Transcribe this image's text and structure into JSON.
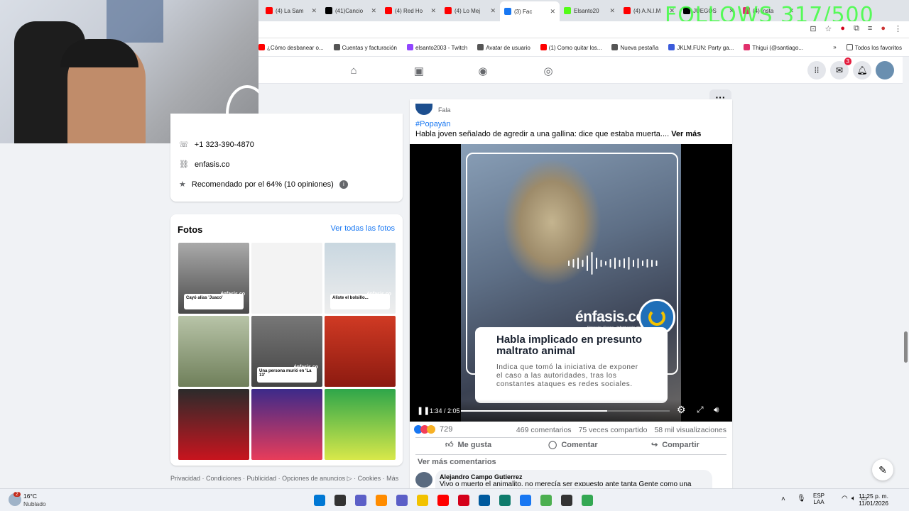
{
  "browser": {
    "tabs": [
      {
        "label": "(4) La Sam",
        "color": "#ff0000"
      },
      {
        "label": "(41)Cancio",
        "color": "#000000"
      },
      {
        "label": "(4) Red Ho",
        "color": "#ff0000"
      },
      {
        "label": "(4) Lo Mej",
        "color": "#ff0000"
      },
      {
        "label": "(3) Fac",
        "color": "#1877f2"
      },
      {
        "label": "Elsanto20",
        "color": "#53fc18"
      },
      {
        "label": "(4) A.N.I.M",
        "color": "#ff0000"
      },
      {
        "label": "JUEGOS",
        "color": "#000000"
      },
      {
        "label": "(4) Insta",
        "color": "#e1306c"
      }
    ],
    "bookmarks": [
      {
        "label": "¿Cómo desbanear o...",
        "color": "#ff0000"
      },
      {
        "label": "Cuentas y facturación",
        "color": "#555555"
      },
      {
        "label": "elsanto2003 - Twitch",
        "color": "#9146ff"
      },
      {
        "label": "Avatar de usuario",
        "color": "#555555"
      },
      {
        "label": "(1) Como quitar los...",
        "color": "#ff0000"
      },
      {
        "label": "Nueva pestaña",
        "color": "#555555"
      },
      {
        "label": "JKLM.FUN: Party ga...",
        "color": "#3b5bdb"
      },
      {
        "label": "Thigui (@santiago...",
        "color": "#e1306c"
      }
    ],
    "all_bookmarks": "Todos los favoritos"
  },
  "overlay": {
    "follows": "FOLLOWS 317/500"
  },
  "facebook": {
    "messenger_badge": "3",
    "about": {
      "phone": "+1 323-390-4870",
      "website": "enfasis.co",
      "recommended": "Recomendado por el 64% (10 opiniones)"
    },
    "photos": {
      "title": "Fotos",
      "see_all": "Ver todas las fotos",
      "watermark": "énfasis.co",
      "captions": [
        "Cayó alias 'Juaco'",
        "",
        "Aliste el bolsillo...",
        "",
        "Una persona murió en 'La 13'",
        "",
        "",
        "",
        ""
      ]
    },
    "footer": {
      "links": "Privacidad · Condiciones · Publicidad · Opciones de anuncios",
      "links2": "· Cookies · Más"
    },
    "post": {
      "author_fragment": "Fala",
      "hashtag": "#Popayán",
      "text": "Habla joven señalado de agredir a una gallina: dice que estaba muerta....",
      "see_more": "Ver más",
      "video_brand": "énfasis.co",
      "video_brand_sub": "Popayán, Cauca · Información digital",
      "video_title": "Habla implicado en presunto maltrato animal",
      "video_body": "Indica que tomó la iniciativa de exponer el caso a las autoridades, tras los constantes ataques es redes sociales.",
      "time": "1:34 / 2:05",
      "progress": 0.7,
      "reactions_count": "729",
      "comments": "469 comentarios",
      "shares": "75 veces compartido",
      "views": "58 mil visualizaciones",
      "like": "Me gusta",
      "comment": "Comentar",
      "share": "Compartir",
      "more_comments": "Ver más comentarios",
      "comment_author": "Alejandro Campo Gutierrez",
      "comment_text": "Vivo o muerto el animalito, no merecía ser expuesto ante tanta Gente como una"
    }
  },
  "taskbar": {
    "weather_temp": "16°C",
    "weather_desc": "Nublado",
    "weather_badge": "2",
    "lang1": "ESP",
    "lang2": "LAA",
    "time": "11:25 p. m.",
    "date": "11/01/2026"
  }
}
